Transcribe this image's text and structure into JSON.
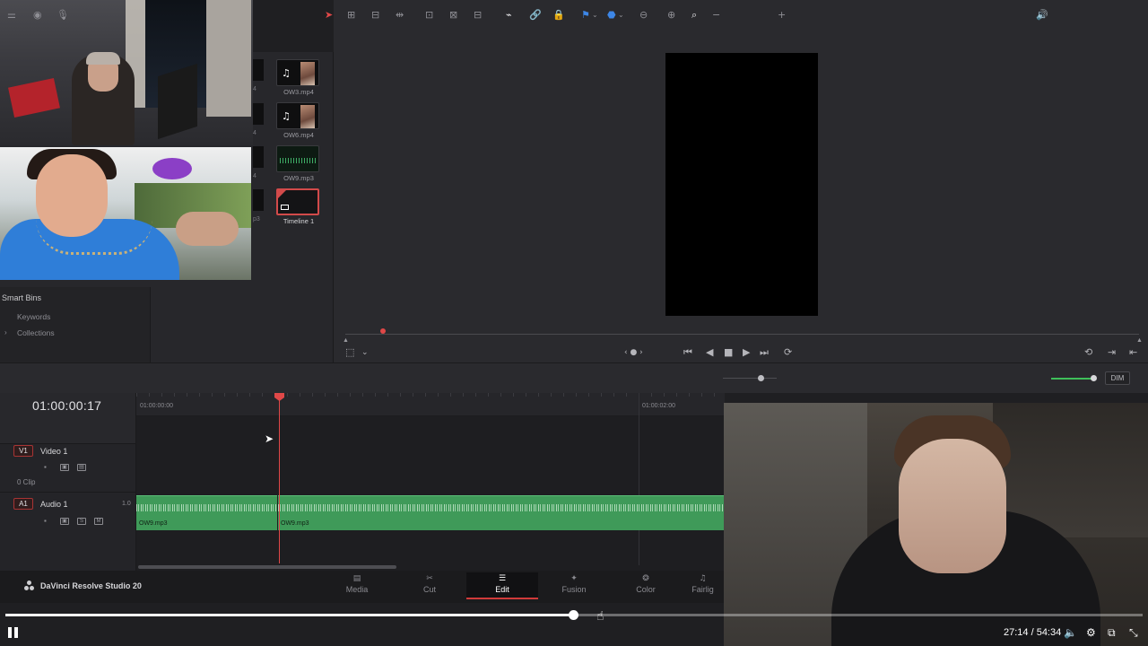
{
  "media_pool": {
    "clips": [
      {
        "name": "OW3.mp4",
        "kind": "video"
      },
      {
        "name": "OW6.mp4",
        "kind": "video"
      },
      {
        "name": "OW9.mp3",
        "kind": "audio"
      },
      {
        "name": "Timeline 1",
        "kind": "timeline"
      }
    ],
    "cut_off_labels": [
      "4",
      "4",
      "4",
      "p3"
    ]
  },
  "smart_bins": {
    "title": "Smart Bins",
    "items": [
      "Keywords",
      "Collections"
    ],
    "chevron": "›"
  },
  "viewer": {
    "transport": {
      "jump_start": "⏮",
      "step_back": "◀",
      "stop": "■",
      "play": "▶",
      "jump_end": "⏭",
      "loop": "⟳"
    },
    "nav_dots": "‹ ● ›",
    "crop_icon": "⬚",
    "crop_dropdown": "⌄",
    "right_icons": [
      "⟲",
      "⇥",
      "⇤"
    ],
    "scrubber_position": 0.048
  },
  "toolbar": {
    "left_icons": [
      "⚌",
      "◉",
      "🎙"
    ],
    "edit_tools": [
      "➤",
      "⊞",
      "⊟",
      "⇹",
      "⊡",
      "⊠",
      "⊟"
    ],
    "snap": "⌁",
    "link": "🔗",
    "lock": "🔒",
    "flag": "⚑",
    "marker": "⬣",
    "zoom_icons": [
      "⊖",
      "⊕",
      "⌕"
    ],
    "zoom_minus": "−",
    "zoom_plus": "+",
    "zoom_level": 0.7,
    "volume_icon": "🔊",
    "volume_level": 0.95,
    "dim_label": "DIM"
  },
  "timeline": {
    "timecode": "01:00:00:17",
    "ruler_labels": [
      "01:00:00:00",
      "01:00:02:00"
    ],
    "tracks": {
      "video": {
        "badge": "V1",
        "name": "Video 1",
        "clip_count": "0 Clip"
      },
      "audio": {
        "badge": "A1",
        "name": "Audio 1",
        "level": "1.0",
        "solo": "S",
        "mute": "M"
      }
    },
    "audio_clips": [
      {
        "name": "OW9.mp3"
      },
      {
        "name": "OW9.mp3"
      }
    ]
  },
  "pages": {
    "brand": "DaVinci Resolve Studio 20",
    "tabs": [
      {
        "label": "Media",
        "icon": "▤",
        "active": false
      },
      {
        "label": "Cut",
        "icon": "✂",
        "active": false
      },
      {
        "label": "Edit",
        "icon": "☰",
        "active": true
      },
      {
        "label": "Fusion",
        "icon": "✦",
        "active": false
      },
      {
        "label": "Color",
        "icon": "❂",
        "active": false
      },
      {
        "label": "Fairlig",
        "icon": "♫",
        "active": false
      }
    ]
  },
  "player": {
    "current_time": "27:14",
    "total_time": "54:34",
    "time_display": "27:14 / 54:34",
    "progress": 0.499,
    "icons": {
      "volume": "🔈",
      "settings": "⚙",
      "miniplayer": "⧉",
      "fullscreen": "⤡"
    }
  }
}
